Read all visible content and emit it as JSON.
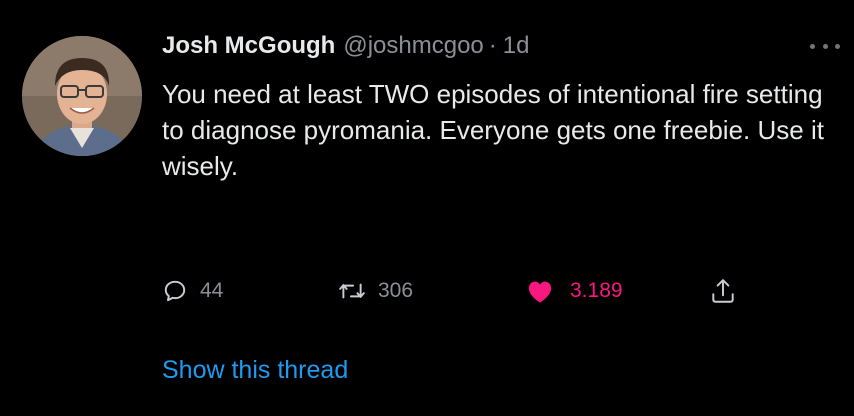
{
  "tweet": {
    "author": {
      "display_name": "Josh McGough",
      "handle": "@joshmcgoo",
      "separator": "·",
      "time": "1d"
    },
    "text": "You need at least TWO episodes of intentional fire setting to diagnose pyromania. Everyone gets one freebie. Use it wisely.",
    "actions": {
      "replies": "44",
      "retweets": "306",
      "likes": "3.189"
    },
    "show_thread_label": "Show this thread"
  },
  "icons": {
    "more": "more-horizontal-icon",
    "reply": "reply-bubble-icon",
    "retweet": "retweet-icon",
    "like": "heart-icon",
    "share": "share-icon"
  },
  "colors": {
    "background": "#000000",
    "text": "#e7e9ea",
    "secondary": "#8b9096",
    "like": "#f91880",
    "link": "#1d9bf0"
  }
}
